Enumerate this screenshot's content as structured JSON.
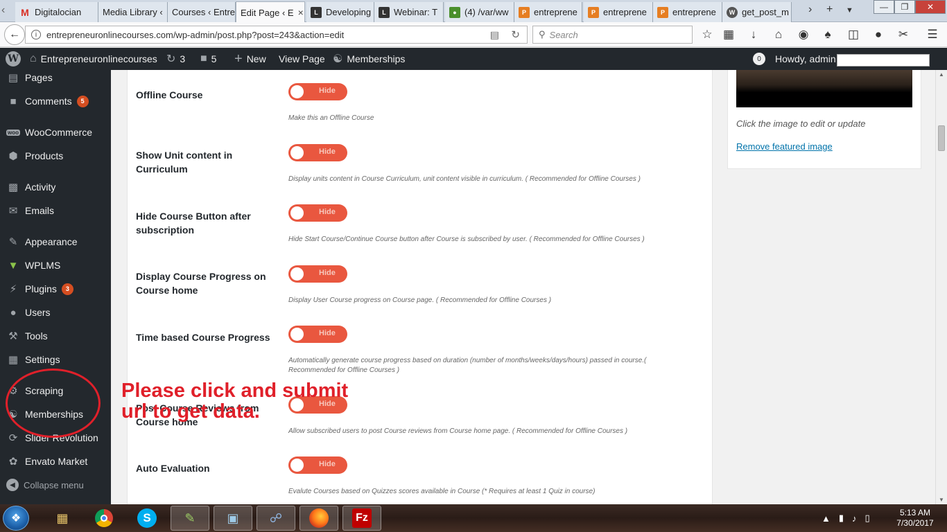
{
  "browser": {
    "tabs": [
      {
        "title": "Digitalocian",
        "favicon": "gmail-icon"
      },
      {
        "title": "Media Library ‹",
        "favicon": ""
      },
      {
        "title": "Courses ‹ Entre",
        "favicon": ""
      },
      {
        "title": "Edit Page ‹ E",
        "favicon": "",
        "active": true
      },
      {
        "title": "Developing",
        "favicon": "lms-icon"
      },
      {
        "title": "Webinar: T",
        "favicon": "lms-icon"
      },
      {
        "title": "(4) /var/ww",
        "favicon": "bug-icon"
      },
      {
        "title": "entreprene",
        "favicon": "pma-icon"
      },
      {
        "title": "entreprene",
        "favicon": "pma-icon"
      },
      {
        "title": "entreprene",
        "favicon": "pma-icon"
      },
      {
        "title": "get_post_m",
        "favicon": "wordpress-icon"
      }
    ],
    "url": "entrepreneuronlinecourses.com/wp-admin/post.php?post=243&action=edit",
    "search_placeholder": "Search"
  },
  "adminbar": {
    "site_name": "Entrepreneuronlinecourses",
    "updates_count": "3",
    "comments_count": "5",
    "new_label": "New",
    "view_page_label": "View Page",
    "memberships_label": "Memberships",
    "avatar_count": "0",
    "greeting": "Howdy, admin"
  },
  "sidebar": {
    "items": [
      {
        "label": "Pages",
        "icon": "pages-icon",
        "badge": ""
      },
      {
        "label": "Comments",
        "icon": "comments-icon",
        "badge": "5"
      },
      {
        "label": "WooCommerce",
        "icon": "woocommerce-icon",
        "badge": ""
      },
      {
        "label": "Products",
        "icon": "products-icon",
        "badge": ""
      },
      {
        "label": "Activity",
        "icon": "activity-icon",
        "badge": ""
      },
      {
        "label": "Emails",
        "icon": "emails-icon",
        "badge": ""
      },
      {
        "label": "Appearance",
        "icon": "appearance-icon",
        "badge": ""
      },
      {
        "label": "WPLMS",
        "icon": "wplms-icon",
        "badge": ""
      },
      {
        "label": "Plugins",
        "icon": "plugins-icon",
        "badge": "3"
      },
      {
        "label": "Users",
        "icon": "users-icon",
        "badge": ""
      },
      {
        "label": "Tools",
        "icon": "tools-icon",
        "badge": ""
      },
      {
        "label": "Settings",
        "icon": "settings-icon",
        "badge": ""
      },
      {
        "label": "Scraping",
        "icon": "scraping-icon",
        "badge": ""
      },
      {
        "label": "Memberships",
        "icon": "memberships-icon",
        "badge": ""
      },
      {
        "label": "Slider Revolution",
        "icon": "slider-revolution-icon",
        "badge": ""
      },
      {
        "label": "Envato Market",
        "icon": "envato-icon",
        "badge": ""
      }
    ],
    "collapse_label": "Collapse menu"
  },
  "settings": [
    {
      "label": "Offline Course",
      "toggle": "Hide",
      "description": "Make this an Offline Course"
    },
    {
      "label": "Show Unit content in Curriculum",
      "toggle": "Hide",
      "description": "Display units content in Course Curriculum, unit content visible in curriculum. ( Recommended for Offline Courses )"
    },
    {
      "label": "Hide Course Button after subscription",
      "toggle": "Hide",
      "description": "Hide Start Course/Continue Course button after Course is subscribed by user. ( Recommended for Offline Courses )"
    },
    {
      "label": "Display Course Progress on Course home",
      "toggle": "Hide",
      "description": "Display User Course progress on Course page. ( Recommended for Offline Courses )"
    },
    {
      "label": "Time based Course Progress",
      "toggle": "Hide",
      "description": "Automatically generate course progress based on duration (number of months/weeks/days/hours) passed in course.( Recommended for Offline Courses )"
    },
    {
      "label": "Post Course Reviews from Course home",
      "toggle": "Hide",
      "description": "Allow subscribed users to post Course reviews from Course home page. ( Recommended for Offline Courses )"
    },
    {
      "label": "Auto Evaluation",
      "toggle": "Hide",
      "description": "Evalute Courses based on Quizzes scores available in Course (* Requires at least 1 Quiz in course)"
    }
  ],
  "featured_image": {
    "hint": "Click the image to edit or update",
    "remove_link": "Remove featured image"
  },
  "annotation": {
    "text": "Please click and submit url to get data.",
    "color": "#e0202a"
  },
  "taskbar": {
    "apps": [
      "windows-explorer-icon",
      "chrome-icon",
      "skype-icon",
      "notepad-icon",
      "editor-icon",
      "network-icon",
      "firefox-icon",
      "filezilla-icon"
    ],
    "time": "5:13 AM",
    "date": "7/30/2017"
  },
  "colors": {
    "toggle_off": "#e9573f",
    "wp_admin_dark": "#23282d",
    "badge": "#d54e21",
    "link": "#0073aa"
  }
}
